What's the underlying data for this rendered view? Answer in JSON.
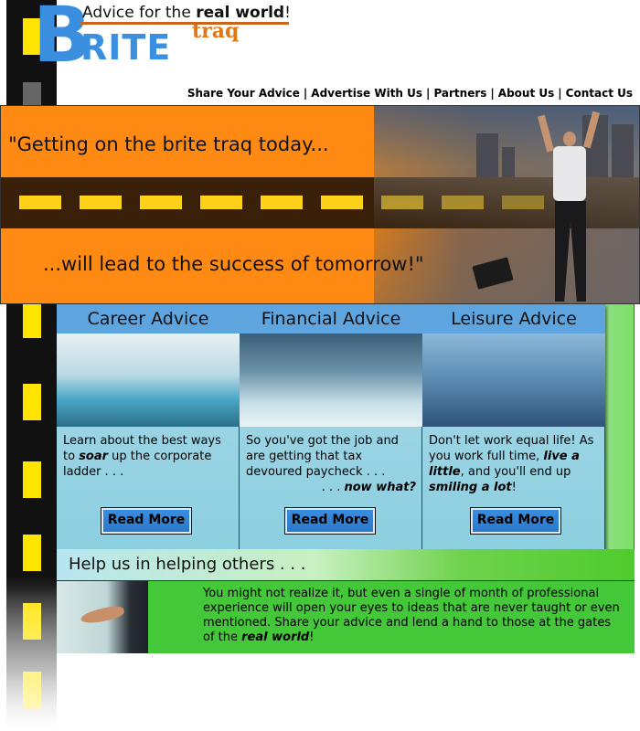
{
  "logo": {
    "letter_b": "B",
    "rite": "RITE",
    "traq": "traq",
    "tagline_pre": "Advice for the ",
    "tagline_bold": "real world",
    "tagline_post": "!",
    "colors": {
      "blue": "#3b8fe0",
      "orange": "#e07818"
    }
  },
  "nav": {
    "items": [
      {
        "label": "Share Your Advice"
      },
      {
        "label": "Advertise With Us"
      },
      {
        "label": "Partners"
      },
      {
        "label": "About Us"
      },
      {
        "label": "Contact Us"
      }
    ],
    "separator": "|"
  },
  "banner": {
    "quote_line_1": "\"Getting on the brite traq today...",
    "quote_line_2": "...will lead to the success of tomorrow!\""
  },
  "columns": [
    {
      "title": "Career Advice",
      "desc_1": "Learn about the best ways to ",
      "desc_bold": "soar",
      "desc_2": " up the corporate ladder . . .",
      "button": "Read More"
    },
    {
      "title": "Financial Advice",
      "desc_1": "So you've got the job and are getting that tax devoured paycheck . . .",
      "desc_bold": "now what?",
      "desc_bold_prefix": ". . . ",
      "button": "Read More"
    },
    {
      "title": "Leisure Advice",
      "desc_1": "Don't let work equal life! As you work full time, ",
      "desc_bold": "live a little",
      "desc_2": ", and you'll end up ",
      "desc_bold_2": "smiling a lot",
      "desc_3": "!",
      "button": "Read More"
    }
  ],
  "help": {
    "heading": "Help us in helping others . . .",
    "text_1": "You might not realize it, but even a single of month of professional experience will open your eyes to ideas that are never taught or even mentioned.  Share your advice and lend a hand to those at the gates of the ",
    "text_bold": "real world",
    "text_2": "!"
  }
}
